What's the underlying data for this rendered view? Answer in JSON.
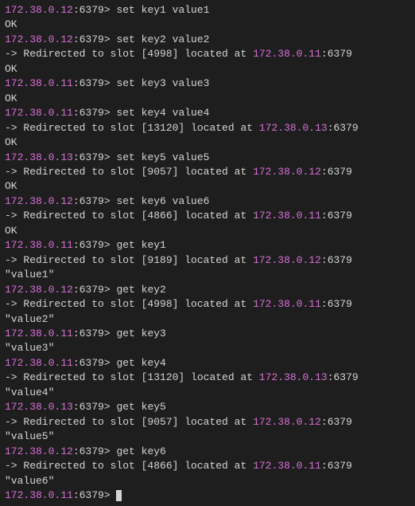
{
  "entries": [
    {
      "prompt_ip": "172.38.0.12",
      "prompt_port": ":6379> ",
      "cmd": "set key1 value1",
      "redirect": null,
      "result": "OK"
    },
    {
      "prompt_ip": "172.38.0.12",
      "prompt_port": ":6379> ",
      "cmd": "set key2 value2",
      "redirect": {
        "prefix": "-> Redirected to slot [4998] located at ",
        "ip": "172.38.0.11",
        "suffix": ":6379"
      },
      "result": "OK"
    },
    {
      "prompt_ip": "172.38.0.11",
      "prompt_port": ":6379> ",
      "cmd": "set key3 value3",
      "redirect": null,
      "result": "OK"
    },
    {
      "prompt_ip": "172.38.0.11",
      "prompt_port": ":6379> ",
      "cmd": "set key4 value4",
      "redirect": {
        "prefix": "-> Redirected to slot [13120] located at ",
        "ip": "172.38.0.13",
        "suffix": ":6379"
      },
      "result": "OK"
    },
    {
      "prompt_ip": "172.38.0.13",
      "prompt_port": ":6379> ",
      "cmd": "set key5 value5",
      "redirect": {
        "prefix": "-> Redirected to slot [9057] located at ",
        "ip": "172.38.0.12",
        "suffix": ":6379"
      },
      "result": "OK"
    },
    {
      "prompt_ip": "172.38.0.12",
      "prompt_port": ":6379> ",
      "cmd": "set key6 value6",
      "redirect": {
        "prefix": "-> Redirected to slot [4866] located at ",
        "ip": "172.38.0.11",
        "suffix": ":6379"
      },
      "result": "OK"
    },
    {
      "prompt_ip": "172.38.0.11",
      "prompt_port": ":6379> ",
      "cmd": "get key1",
      "redirect": {
        "prefix": "-> Redirected to slot [9189] located at ",
        "ip": "172.38.0.12",
        "suffix": ":6379"
      },
      "result": "\"value1\""
    },
    {
      "prompt_ip": "172.38.0.12",
      "prompt_port": ":6379> ",
      "cmd": "get key2",
      "redirect": {
        "prefix": "-> Redirected to slot [4998] located at ",
        "ip": "172.38.0.11",
        "suffix": ":6379"
      },
      "result": "\"value2\""
    },
    {
      "prompt_ip": "172.38.0.11",
      "prompt_port": ":6379> ",
      "cmd": "get key3",
      "redirect": null,
      "result": "\"value3\""
    },
    {
      "prompt_ip": "172.38.0.11",
      "prompt_port": ":6379> ",
      "cmd": "get key4",
      "redirect": {
        "prefix": "-> Redirected to slot [13120] located at ",
        "ip": "172.38.0.13",
        "suffix": ":6379"
      },
      "result": "\"value4\""
    },
    {
      "prompt_ip": "172.38.0.13",
      "prompt_port": ":6379> ",
      "cmd": "get key5",
      "redirect": {
        "prefix": "-> Redirected to slot [9057] located at ",
        "ip": "172.38.0.12",
        "suffix": ":6379"
      },
      "result": "\"value5\""
    },
    {
      "prompt_ip": "172.38.0.12",
      "prompt_port": ":6379> ",
      "cmd": "get key6",
      "redirect": {
        "prefix": "-> Redirected to slot [4866] located at ",
        "ip": "172.38.0.11",
        "suffix": ":6379"
      },
      "result": "\"value6\""
    }
  ],
  "final_prompt": {
    "ip": "172.38.0.11",
    "port": ":6379> "
  }
}
